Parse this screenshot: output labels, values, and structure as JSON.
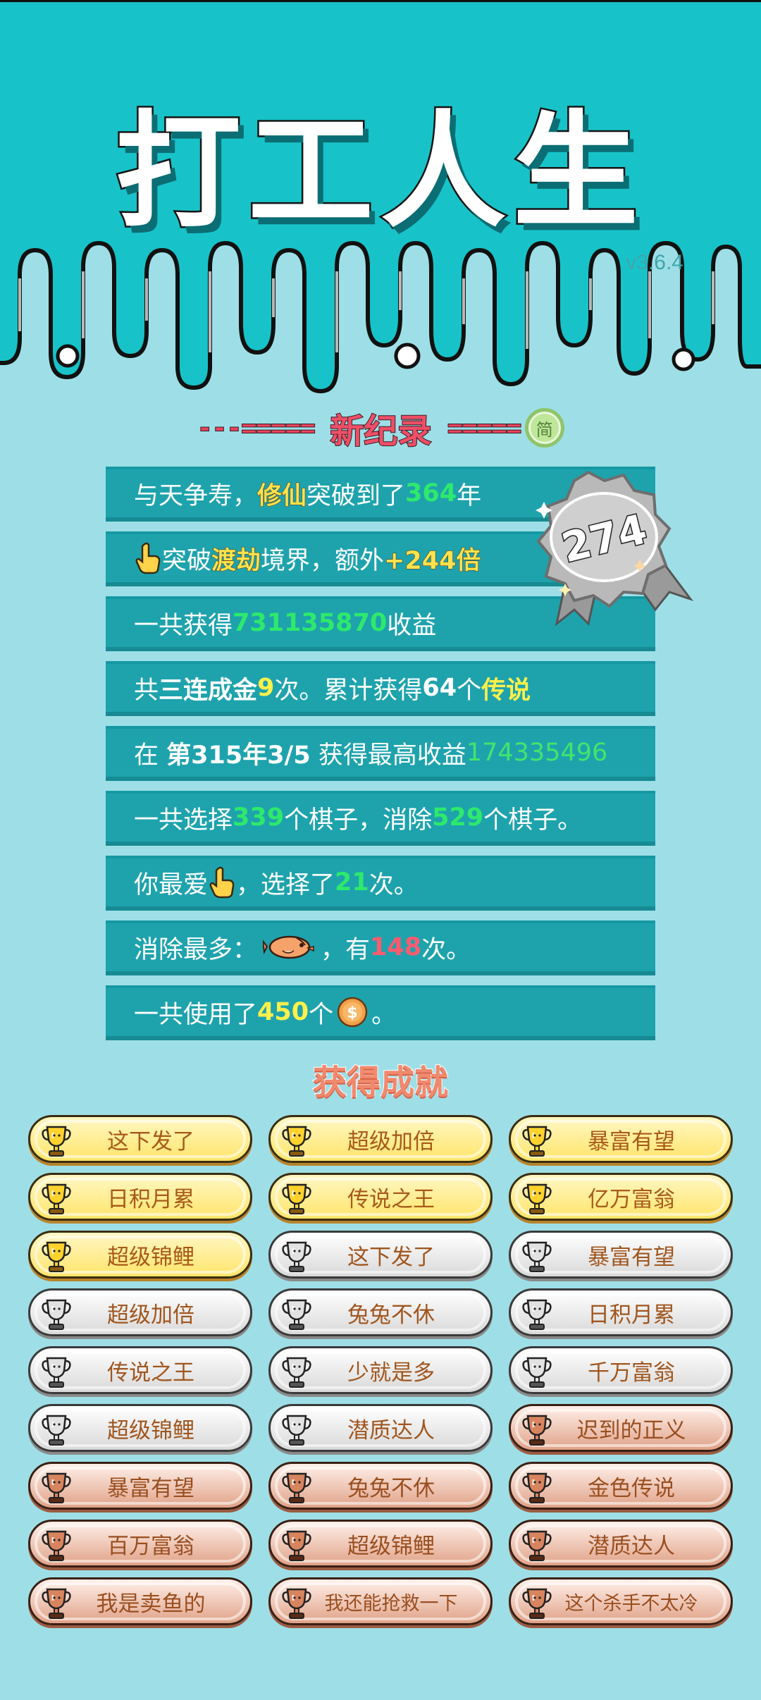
{
  "app": {
    "title": "打工人生",
    "version": "v3.6.4"
  },
  "record": {
    "title": "新纪录",
    "dashes_left": "---=====",
    "dashes_right": "=====",
    "simplified_badge": "简",
    "medal_number": "274"
  },
  "stats": {
    "line1": {
      "a": "与天争寿，",
      "b": "修仙",
      "c": "突破到了",
      "d": "364",
      "e": "年"
    },
    "line2": {
      "a": "突破",
      "b": "渡劫",
      "c": "境界，额外",
      "d": "+244倍"
    },
    "line3": {
      "a": "一共获得",
      "b": "731135870",
      "c": "收益"
    },
    "line4": {
      "a": "共",
      "b": "三连成金",
      "c": "9",
      "d": "次。累计获得",
      "e": "64",
      "f": "个",
      "g": "传说"
    },
    "line5": {
      "a": "在 ",
      "b": "第315年3/5",
      "c": " 获得最高收益",
      "d": "174335496"
    },
    "line6": {
      "a": "一共选择",
      "b": "339",
      "c": "个棋子，消除",
      "d": "529",
      "e": "个棋子。"
    },
    "line7": {
      "a": "你最爱",
      "b": "，选择了",
      "c": "21",
      "d": "次。"
    },
    "line8": {
      "a": "消除最多：",
      "b": "，有",
      "c": "148",
      "d": "次。"
    },
    "line9": {
      "a": "一共使用了",
      "b": "450",
      "c": "个",
      "d": "。"
    }
  },
  "achievements_title": "获得成就",
  "achievements": [
    {
      "label": "这下发了",
      "tier": "gold"
    },
    {
      "label": "超级加倍",
      "tier": "gold"
    },
    {
      "label": "暴富有望",
      "tier": "gold"
    },
    {
      "label": "日积月累",
      "tier": "gold"
    },
    {
      "label": "传说之王",
      "tier": "gold"
    },
    {
      "label": "亿万富翁",
      "tier": "gold"
    },
    {
      "label": "超级锦鲤",
      "tier": "gold"
    },
    {
      "label": "这下发了",
      "tier": "silver"
    },
    {
      "label": "暴富有望",
      "tier": "silver"
    },
    {
      "label": "超级加倍",
      "tier": "silver"
    },
    {
      "label": "兔兔不休",
      "tier": "silver"
    },
    {
      "label": "日积月累",
      "tier": "silver"
    },
    {
      "label": "传说之王",
      "tier": "silver"
    },
    {
      "label": "少就是多",
      "tier": "silver"
    },
    {
      "label": "千万富翁",
      "tier": "silver"
    },
    {
      "label": "超级锦鲤",
      "tier": "silver"
    },
    {
      "label": "潜质达人",
      "tier": "silver"
    },
    {
      "label": "迟到的正义",
      "tier": "bronze"
    },
    {
      "label": "暴富有望",
      "tier": "bronze"
    },
    {
      "label": "兔兔不休",
      "tier": "bronze"
    },
    {
      "label": "金色传说",
      "tier": "bronze"
    },
    {
      "label": "百万富翁",
      "tier": "bronze"
    },
    {
      "label": "超级锦鲤",
      "tier": "bronze"
    },
    {
      "label": "潜质达人",
      "tier": "bronze"
    },
    {
      "label": "我是卖鱼的",
      "tier": "bronze"
    },
    {
      "label": "我还能抢救一下",
      "tier": "bronze"
    },
    {
      "label": "这个杀手不太冷",
      "tier": "bronze"
    }
  ],
  "colors": {
    "top_bg": "#17c3c8",
    "page_bg": "#9edfe7",
    "stat_bar": "#1ea3ad",
    "highlight_green": "#2ee96c",
    "highlight_yellow": "#fff04a",
    "highlight_red": "#ff5a6e",
    "record_red": "#ee4f66",
    "gold": "#ffe56b",
    "silver": "#d9d9d9",
    "bronze": "#e0a288"
  },
  "icons": {
    "hand": "pointing-hand-icon",
    "fish": "fish-icon",
    "coin": "coin-icon",
    "trophy": "trophy-icon",
    "medal": "medal-ribbon-icon"
  }
}
